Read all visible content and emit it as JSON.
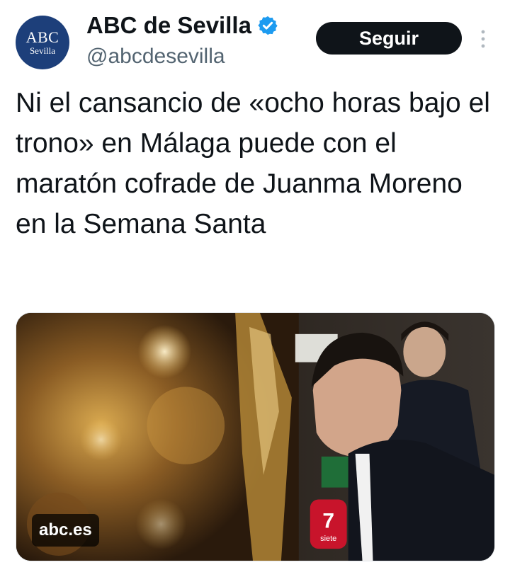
{
  "account": {
    "display_name": "ABC de Sevilla",
    "handle": "@abcdesevilla",
    "verified": true,
    "avatar_logo_main": "ABC",
    "avatar_logo_sub": "Sevilla"
  },
  "actions": {
    "follow_label": "Seguir",
    "more_icon": "more-vertical-icon"
  },
  "tweet": {
    "text": "Ni el cansancio de «ocho horas bajo el trono» en Málaga puede con el maratón cofrade de Juanma Moreno en la Semana Santa"
  },
  "media": {
    "domain": "abc.es",
    "microphone_logo_text": "siete",
    "microphone_logo_number": "7"
  },
  "colors": {
    "avatar_bg": "#1d3f7a",
    "verified_blue": "#1d9bf0",
    "follow_bg": "#0f1419",
    "text": "#0f1419",
    "secondary_text": "#536471"
  }
}
